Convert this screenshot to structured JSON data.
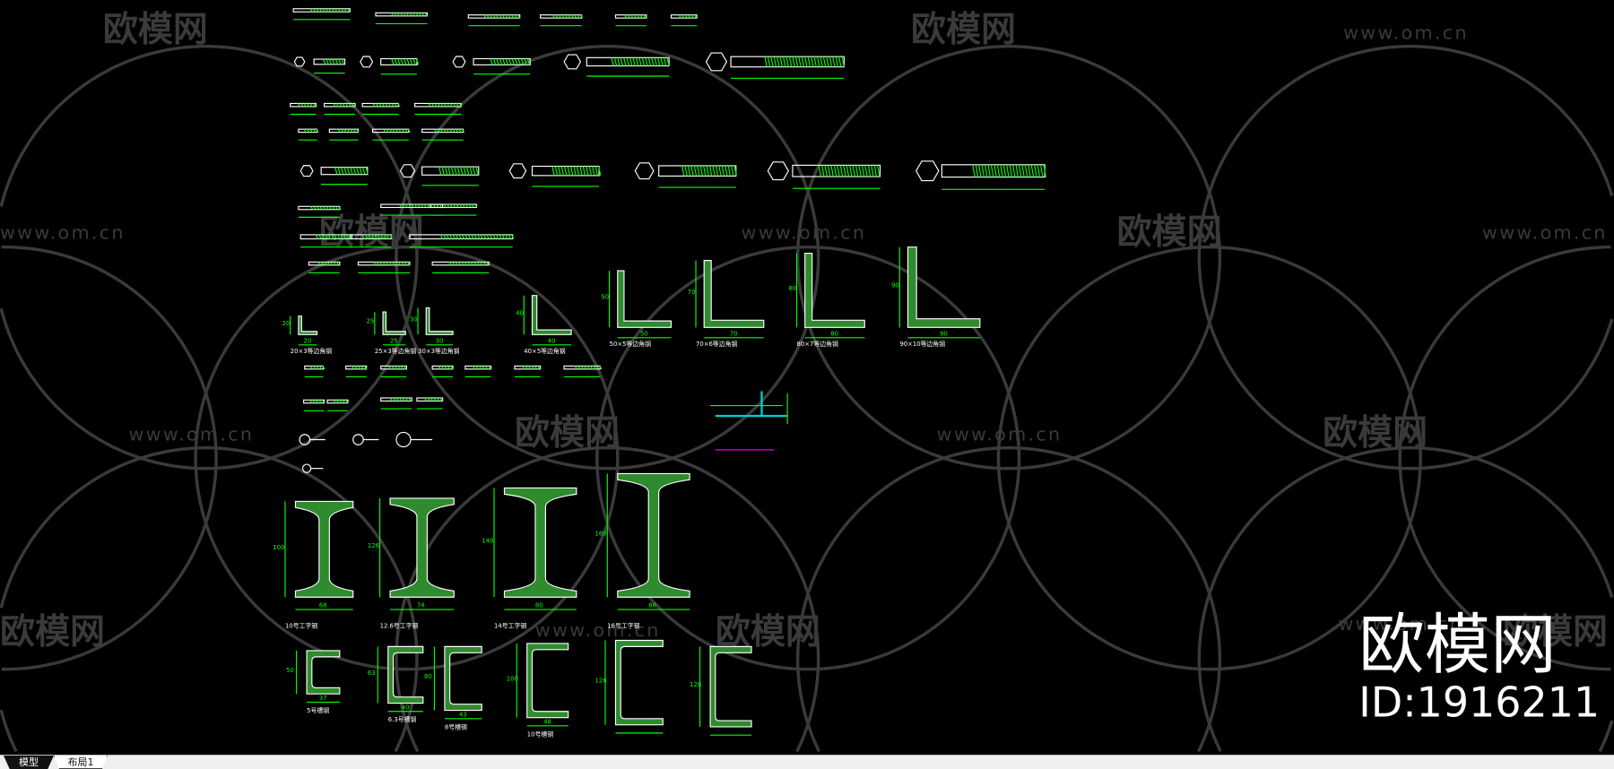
{
  "tabs": [
    {
      "label": "模型",
      "active": true
    },
    {
      "label": "布局1",
      "active": false
    }
  ],
  "watermark": {
    "logo_text": "欧模网",
    "url_text": "www.om.cn",
    "big_text": "欧模网",
    "id_text": "ID:1916211"
  },
  "colors": {
    "background": "#000000",
    "geometry": "#ffffff",
    "dimension": "#00ff00",
    "hatch": "#2e8b2e",
    "watermark": "#3a3a3a",
    "accent_magenta": "#ff00ff",
    "accent_cyan": "#00cccc"
  },
  "angles": [
    {
      "label": "20×3等边角钢",
      "dim": "20"
    },
    {
      "label": "25×3等边角钢",
      "dim": "25"
    },
    {
      "label": "30×3等边角钢",
      "dim": "30"
    },
    {
      "label": "40×5等边角钢",
      "dim": "40"
    },
    {
      "label": "50×5等边角钢",
      "dim": "50"
    },
    {
      "label": "70×6等边角钢",
      "dim": "70"
    },
    {
      "label": "80×7等边角钢",
      "dim": "80"
    },
    {
      "label": "90×10等边角钢",
      "dim": "90"
    }
  ],
  "ibeams": [
    {
      "label": "10号工字钢",
      "height": "100",
      "width": "68"
    },
    {
      "label": "12.6号工字钢",
      "height": "126",
      "width": "74"
    },
    {
      "label": "14号工字钢",
      "height": "140",
      "width": "80"
    },
    {
      "label": "16号工字钢",
      "height": "160",
      "width": "88"
    }
  ],
  "channels": [
    {
      "label": "5号槽钢",
      "height": "50",
      "width": "37"
    },
    {
      "label": "6.3号槽钢",
      "height": "63",
      "width": "40"
    },
    {
      "label": "8号槽钢",
      "height": "80",
      "width": "43"
    },
    {
      "label": "10号槽钢",
      "height": "100",
      "width": "48"
    },
    {
      "label": "",
      "height": "126",
      "width": ""
    },
    {
      "label": "",
      "height": "126",
      "width": ""
    }
  ]
}
